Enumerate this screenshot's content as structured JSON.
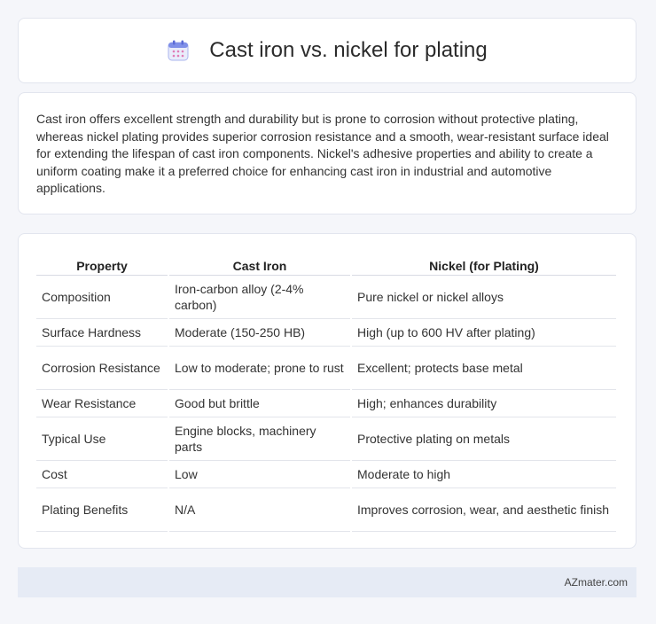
{
  "header": {
    "title": "Cast iron vs. nickel for plating",
    "icon": "calendar-icon",
    "icon_color": "#6d7fe0"
  },
  "intro": {
    "text": "Cast iron offers excellent strength and durability but is prone to corrosion without protective plating, whereas nickel plating provides superior corrosion resistance and a smooth, wear-resistant surface ideal for extending the lifespan of cast iron components. Nickel's adhesive properties and ability to create a uniform coating make it a preferred choice for enhancing cast iron in industrial and automotive applications."
  },
  "table": {
    "headers": [
      "Property",
      "Cast Iron",
      "Nickel (for Plating)"
    ],
    "rows": [
      [
        "Composition",
        "Iron-carbon alloy (2-4% carbon)",
        "Pure nickel or nickel alloys"
      ],
      [
        "Surface Hardness",
        "Moderate (150-250 HB)",
        "High (up to 600 HV after plating)"
      ],
      [
        "Corrosion Resistance",
        "Low to moderate; prone to rust",
        "Excellent; protects base metal"
      ],
      [
        "Wear Resistance",
        "Good but brittle",
        "High; enhances durability"
      ],
      [
        "Typical Use",
        "Engine blocks, machinery parts",
        "Protective plating on metals"
      ],
      [
        "Cost",
        "Low",
        "Moderate to high"
      ],
      [
        "Plating Benefits",
        "N/A",
        "Improves corrosion, wear, and aesthetic finish"
      ]
    ]
  },
  "footer": {
    "brand": "AZmater.com"
  }
}
